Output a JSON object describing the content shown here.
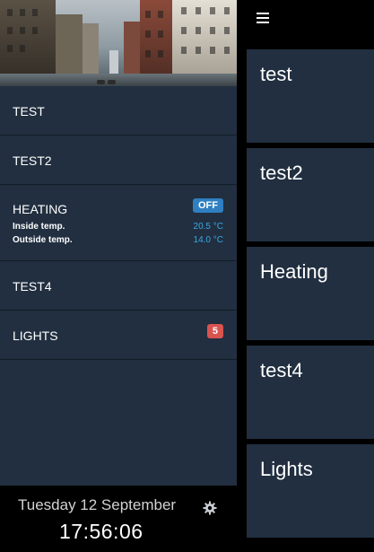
{
  "sidebar": {
    "items": [
      {
        "label": "TEST"
      },
      {
        "label": "TEST2"
      },
      {
        "label": "HEATING",
        "status": "OFF",
        "inside_label": "Inside temp.",
        "inside_value": "20.5 °C",
        "outside_label": "Outside temp.",
        "outside_value": "14.0 °C"
      },
      {
        "label": "TEST4"
      },
      {
        "label": "LIGHTS",
        "count": "5"
      }
    ]
  },
  "footer": {
    "date": "Tuesday 12 September",
    "time": "17:56:06",
    "settings_icon": "gear-icon"
  },
  "header": {
    "menu_icon": "hamburger-icon"
  },
  "tiles": [
    {
      "label": "test"
    },
    {
      "label": "test2"
    },
    {
      "label": "Heating"
    },
    {
      "label": "test4"
    },
    {
      "label": "Lights"
    }
  ],
  "colors": {
    "panel": "#212f40",
    "background": "#000000",
    "status_off": "#2f7fc1",
    "count_badge": "#d9534f",
    "temp_value": "#3aa7e6"
  }
}
